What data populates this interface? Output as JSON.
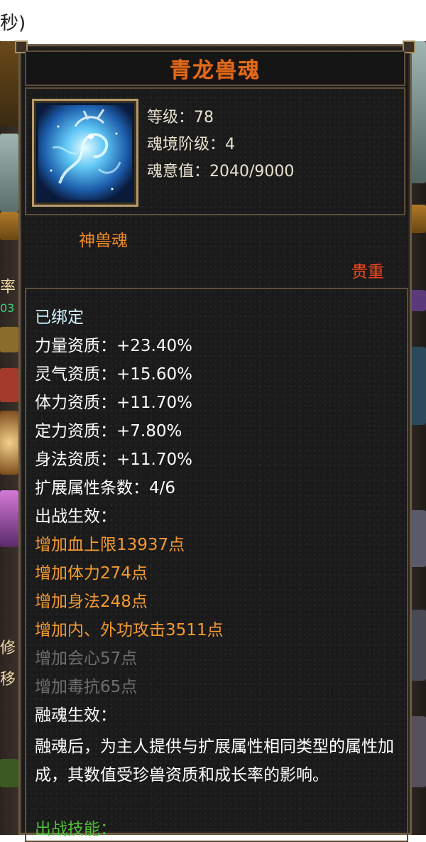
{
  "top_fragment": "秒)",
  "left_side_labels": [
    "率",
    "03",
    "修",
    "移"
  ],
  "tooltip": {
    "title": "青龙兽魂",
    "icon": "azure-dragon-spirit-icon",
    "level": "等级：78",
    "realm_tier": "魂境阶级：4",
    "soul_value": "魂意值：2040/9000",
    "type": "神兽魂",
    "rarity": "贵重",
    "bound": "已绑定",
    "attributes": [
      "力量资质：+23.40%",
      "灵气资质：+15.60%",
      "体力资质：+11.70%",
      "定力资质：+7.80%",
      "身法资质：+11.70%"
    ],
    "extension_count": "扩展属性条数：4/6",
    "battle_effect_header": "出战生效：",
    "active_effects": [
      "增加血上限13937点",
      "增加体力274点",
      "增加身法248点",
      "增加内、外功攻击3511点"
    ],
    "inactive_effects": [
      "增加会心57点",
      "增加毒抗65点"
    ],
    "fusion_header": "融魂生效：",
    "fusion_desc": "融魂后，为主人提供与扩展属性相同类型的属性加成，其数值受珍兽资质和成长率的影响。",
    "battle_skill_header": "出战技能："
  },
  "colors": {
    "title": "#e06a1c",
    "type": "#f08a2a",
    "rarity": "#ff4a1e",
    "active_effect": "#f59a32",
    "inactive_effect": "#6f6f6f",
    "skill": "#4fbf3a"
  }
}
